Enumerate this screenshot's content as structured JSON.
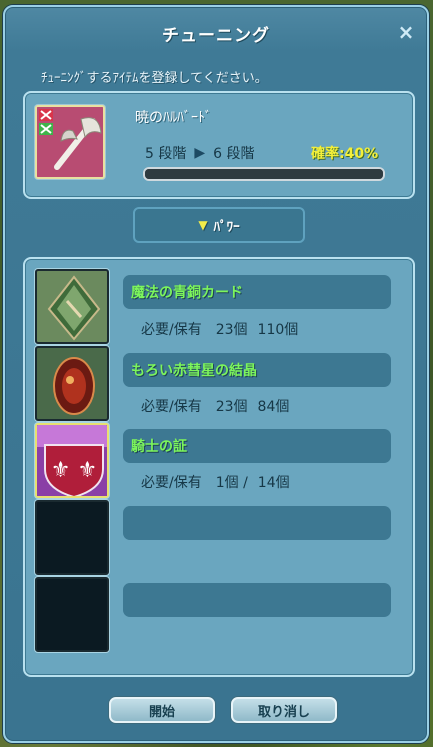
{
  "window": {
    "title": "チューニング",
    "close_icon": "×",
    "instruction": "ﾁｭｰﾆﾝｸﾞするｱｲﾃﾑを登録してください。"
  },
  "target": {
    "name": "暁のﾊﾙﾊﾞｰﾄﾞ",
    "from_stage": "5 段階",
    "arrow": "▶",
    "to_stage": "6 段階",
    "rate": "確率:40%",
    "icon": "halberd-icon"
  },
  "power_button": {
    "arrow": "▼",
    "label": "ﾊﾟﾜｰ"
  },
  "materials": [
    {
      "name": "魔法の青銅カード",
      "count_label": "必要/保有",
      "required": "23個",
      "owned": "110個",
      "icon": "bronze-card-icon"
    },
    {
      "name": "もろい赤彗星の結晶",
      "count_label": "必要/保有",
      "required": "23個",
      "owned": "84個",
      "icon": "red-crystal-icon"
    },
    {
      "name": "騎士の証",
      "count_label": "必要/保有",
      "required": "1個 /",
      "owned": "14個",
      "icon": "knight-crest-icon"
    },
    {
      "name": "",
      "count_label": "",
      "required": "",
      "owned": "",
      "icon": ""
    },
    {
      "name": "",
      "count_label": "",
      "required": "",
      "owned": "",
      "icon": ""
    }
  ],
  "buttons": {
    "start": "開始",
    "cancel": "取り消し"
  },
  "colors": {
    "window_bg": "#3a7490",
    "panel_bg": "#6aa6bf",
    "material_name": "#7cf55c",
    "rate": "#f3ef3a"
  }
}
